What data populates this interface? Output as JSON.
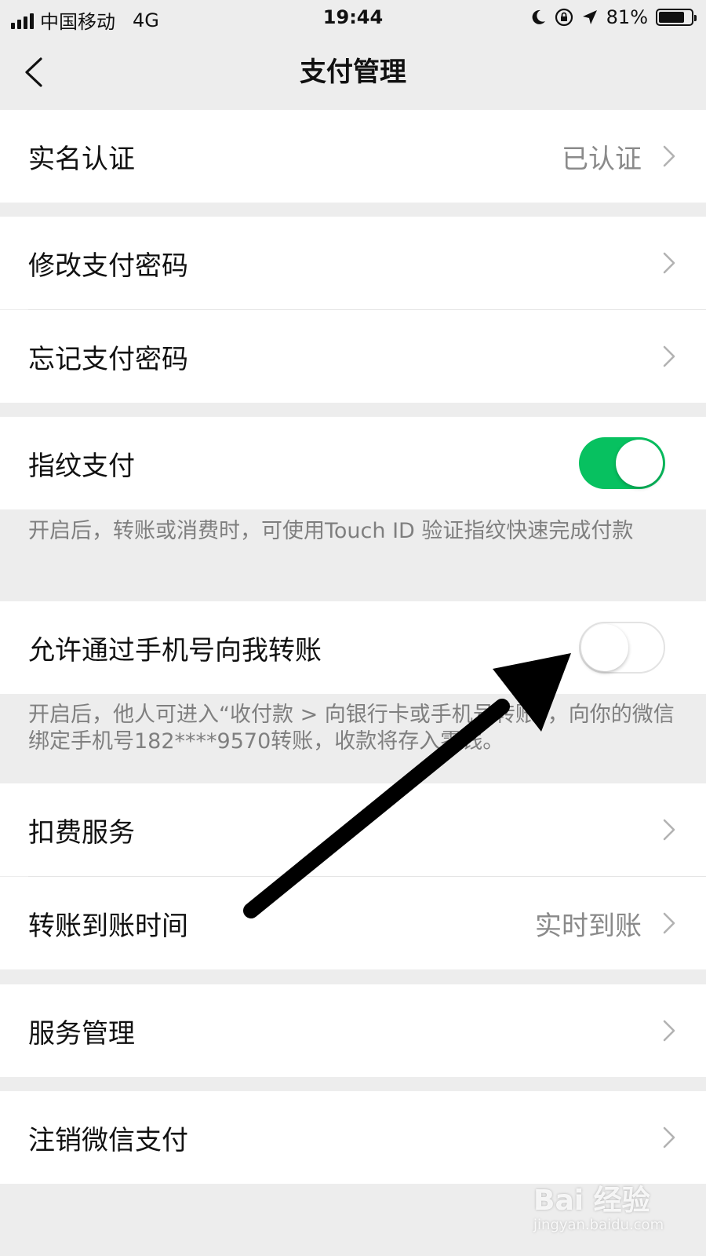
{
  "status_bar": {
    "carrier": "中国移动",
    "network": "4G",
    "time": "19:44",
    "battery_percent": "81%",
    "battery_level": 0.81
  },
  "nav": {
    "back_icon": "chevron-left-icon",
    "title": "支付管理"
  },
  "rows": {
    "real_name": {
      "label": "实名认证",
      "value": "已认证"
    },
    "change_password": {
      "label": "修改支付密码"
    },
    "forgot_password": {
      "label": "忘记支付密码"
    },
    "fingerprint": {
      "label": "指纹支付",
      "enabled": true,
      "description": "开启后，转账或消费时，可使用Touch ID 验证指纹快速完成付款"
    },
    "phone_transfer": {
      "label": "允许通过手机号向我转账",
      "enabled": false,
      "description": "开启后，他人可进入“收付款 > 向银行卡或手机号转账”，向你的微信绑定手机号182****9570转账，收款将存入零钱。"
    },
    "deduction": {
      "label": "扣费服务"
    },
    "arrival_time": {
      "label": "转账到账时间",
      "value": "实时到账"
    },
    "service_manage": {
      "label": "服务管理"
    },
    "cancel_pay": {
      "label": "注销微信支付"
    }
  },
  "colors": {
    "toggle_on": "#07c160",
    "background": "#ededed",
    "row": "#ffffff",
    "annotation_arrow": "#000000"
  },
  "watermark": {
    "logo": "Bai 经验",
    "url": "jingyan.baidu.com"
  }
}
